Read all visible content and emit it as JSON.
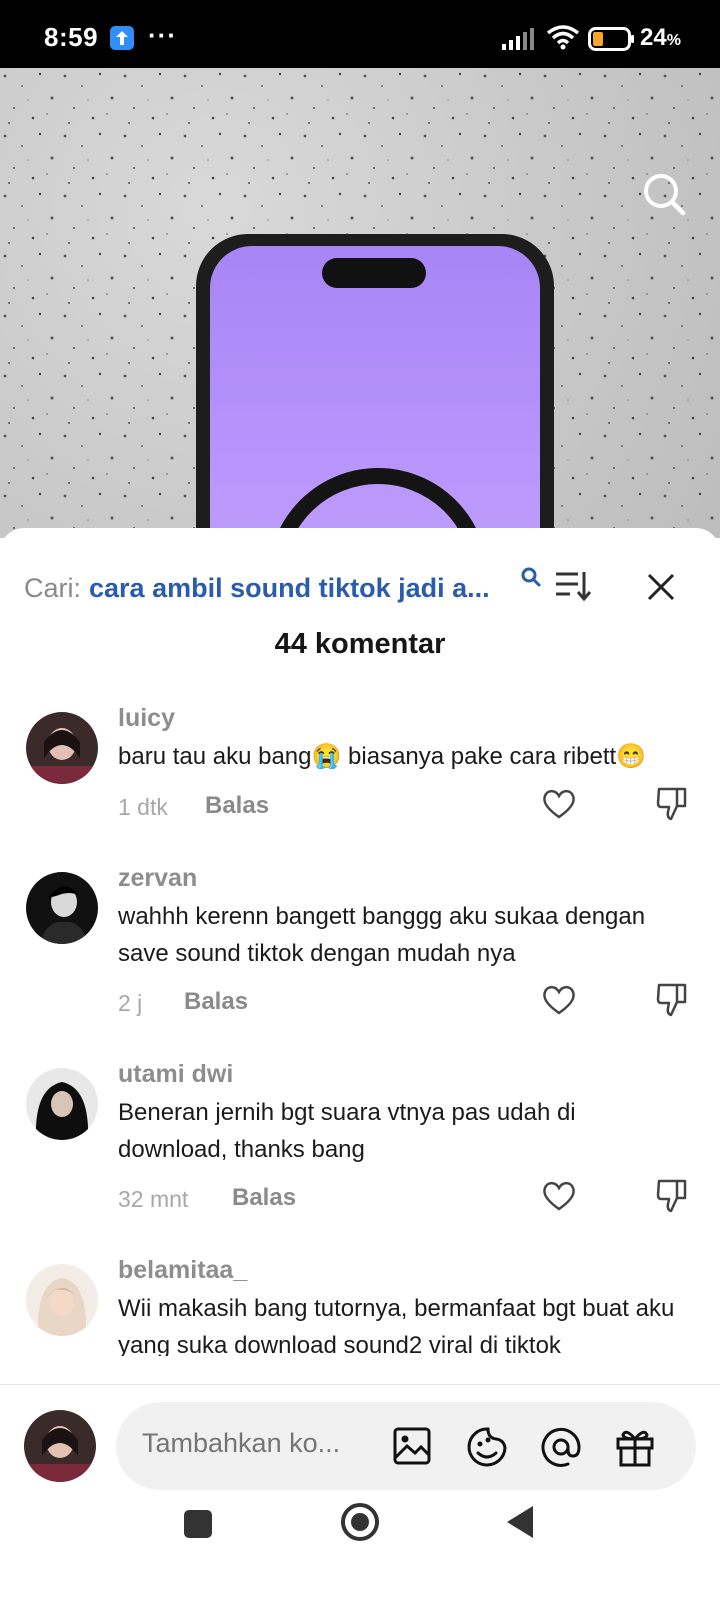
{
  "status_bar": {
    "time": "8:59",
    "dots": "···",
    "battery_percent": "24",
    "battery_unit": "%"
  },
  "search": {
    "prefix": "Cari:",
    "query": "cara ambil sound tiktok jadi a..."
  },
  "comments_count_label": "44 komentar",
  "comments": [
    {
      "username": "luicy",
      "text": "baru tau aku bang😭 biasanya pake cara ribett😁",
      "time": "1 dtk",
      "reply_label": "Balas"
    },
    {
      "username": "zervan",
      "text": "wahhh kerenn bangett banggg aku sukaa dengan save sound tiktok dengan mudah nya",
      "time": "2 j",
      "reply_label": "Balas"
    },
    {
      "username": "utami dwi",
      "text": "Beneran jernih bgt suara vtnya pas udah di download, thanks bang",
      "time": "32 mnt",
      "reply_label": "Balas"
    },
    {
      "username": "belamitaa_",
      "text": "Wii makasih bang tutornya, bermanfaat bgt buat aku yang suka download sound2 viral di tiktok",
      "time": "",
      "reply_label": ""
    }
  ],
  "composer": {
    "placeholder": "Tambahkan ko..."
  },
  "colors": {
    "query_blue": "#2a5cab",
    "video_phone_purple": "#b895fb"
  }
}
